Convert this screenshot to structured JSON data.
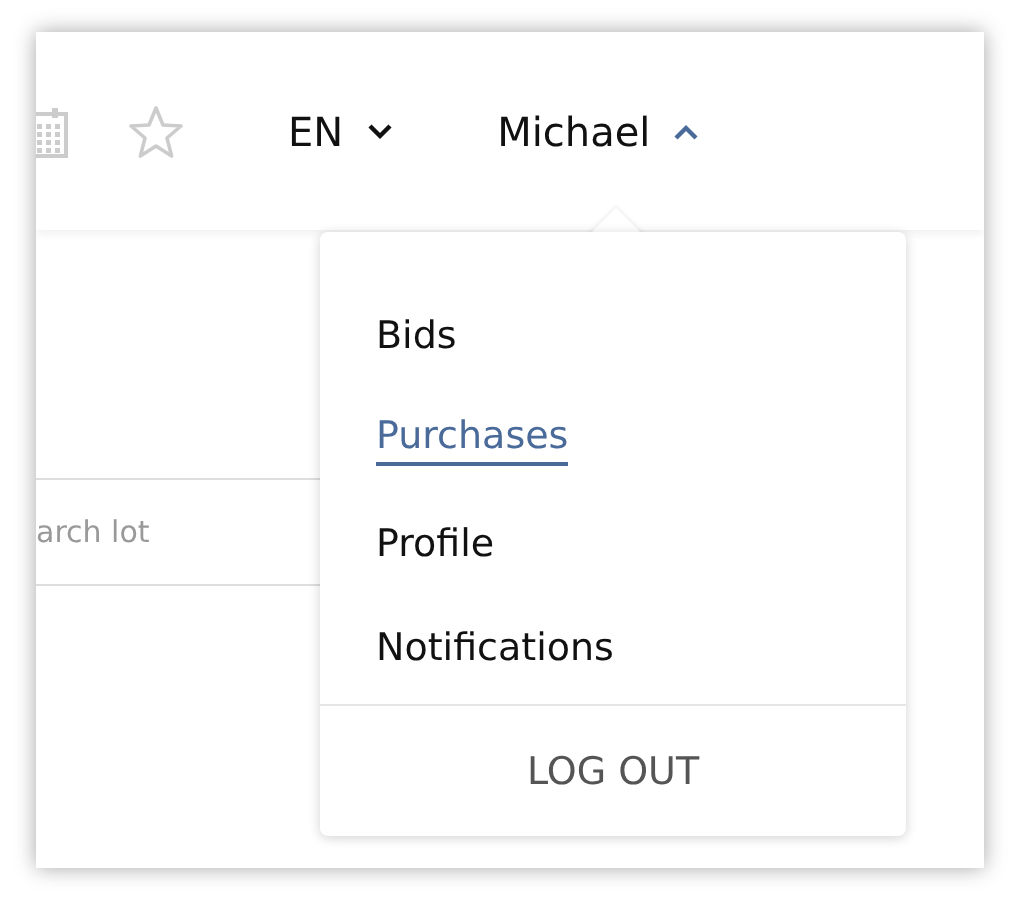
{
  "header": {
    "language": {
      "label": "EN",
      "expanded": false
    },
    "user": {
      "name": "Michael",
      "expanded": true
    }
  },
  "search": {
    "placeholder": "arch lot"
  },
  "user_menu": {
    "items": [
      {
        "label": "Bids",
        "selected": false
      },
      {
        "label": "Purchases",
        "selected": true
      },
      {
        "label": "Profile",
        "selected": false
      },
      {
        "label": "Notifications",
        "selected": false
      }
    ],
    "logout": "LOG OUT"
  }
}
